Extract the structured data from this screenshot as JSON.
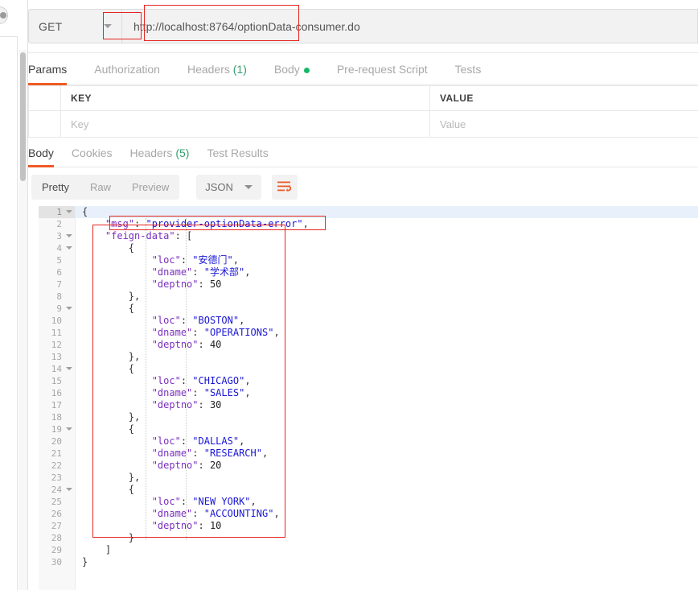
{
  "request": {
    "method": "GET",
    "method_icon": "chevron-down-icon",
    "url": "http://localhost:8764/optionData-consumer.do",
    "tabs": [
      {
        "label": "Params",
        "active": true,
        "suffix": ""
      },
      {
        "label": "Authorization",
        "active": false,
        "suffix": ""
      },
      {
        "label": "Headers",
        "active": false,
        "suffix": "(1)"
      },
      {
        "label": "Body",
        "active": false,
        "suffix": "",
        "dot": true
      },
      {
        "label": "Pre-request Script",
        "active": false,
        "suffix": ""
      },
      {
        "label": "Tests",
        "active": false,
        "suffix": ""
      }
    ]
  },
  "params_table": {
    "headers": [
      "",
      "KEY",
      "VALUE"
    ],
    "rows": [
      {
        "check": "",
        "key_placeholder": "Key",
        "value_placeholder": "Value"
      }
    ]
  },
  "response": {
    "tabs": [
      {
        "label": "Body",
        "active": true,
        "suffix": ""
      },
      {
        "label": "Cookies",
        "active": false,
        "suffix": ""
      },
      {
        "label": "Headers",
        "active": false,
        "suffix": "(5)"
      },
      {
        "label": "Test Results",
        "active": false,
        "suffix": ""
      }
    ],
    "view_modes": [
      {
        "label": "Pretty",
        "active": true
      },
      {
        "label": "Raw",
        "active": false
      },
      {
        "label": "Preview",
        "active": false
      }
    ],
    "format": "JSON",
    "format_icon": "chevron-down-icon",
    "wrap_icon": "wrap-lines-icon"
  },
  "body_json": {
    "msg": "provider-optionData-error",
    "feign-data": [
      {
        "loc": "安德门",
        "dname": "学术部",
        "deptno": 50
      },
      {
        "loc": "BOSTON",
        "dname": "OPERATIONS",
        "deptno": 40
      },
      {
        "loc": "CHICAGO",
        "dname": "SALES",
        "deptno": 30
      },
      {
        "loc": "DALLAS",
        "dname": "RESEARCH",
        "deptno": 20
      },
      {
        "loc": "NEW YORK",
        "dname": "ACCOUNTING",
        "deptno": 10
      }
    ]
  },
  "code_lines": [
    {
      "no": "1",
      "fold": true,
      "current": true,
      "tokens": [
        {
          "t": "{",
          "c": "p"
        }
      ]
    },
    {
      "no": "2",
      "fold": false,
      "current": false,
      "tokens": [
        {
          "t": "    ",
          "c": "p"
        },
        {
          "t": "\"msg\"",
          "c": "k"
        },
        {
          "t": ": ",
          "c": "p"
        },
        {
          "t": "\"provider-optionData-error\"",
          "c": "s"
        },
        {
          "t": ",",
          "c": "p"
        }
      ]
    },
    {
      "no": "3",
      "fold": true,
      "current": false,
      "tokens": [
        {
          "t": "    ",
          "c": "p"
        },
        {
          "t": "\"feign-data\"",
          "c": "k"
        },
        {
          "t": ": [",
          "c": "p"
        }
      ]
    },
    {
      "no": "4",
      "fold": true,
      "current": false,
      "tokens": [
        {
          "t": "        {",
          "c": "p"
        }
      ]
    },
    {
      "no": "5",
      "fold": false,
      "current": false,
      "tokens": [
        {
          "t": "            ",
          "c": "p"
        },
        {
          "t": "\"loc\"",
          "c": "k"
        },
        {
          "t": ": ",
          "c": "p"
        },
        {
          "t": "\"安德门\"",
          "c": "s"
        },
        {
          "t": ",",
          "c": "p"
        }
      ]
    },
    {
      "no": "6",
      "fold": false,
      "current": false,
      "tokens": [
        {
          "t": "            ",
          "c": "p"
        },
        {
          "t": "\"dname\"",
          "c": "k"
        },
        {
          "t": ": ",
          "c": "p"
        },
        {
          "t": "\"学术部\"",
          "c": "s"
        },
        {
          "t": ",",
          "c": "p"
        }
      ]
    },
    {
      "no": "7",
      "fold": false,
      "current": false,
      "tokens": [
        {
          "t": "            ",
          "c": "p"
        },
        {
          "t": "\"deptno\"",
          "c": "k"
        },
        {
          "t": ": ",
          "c": "p"
        },
        {
          "t": "50",
          "c": "n"
        }
      ]
    },
    {
      "no": "8",
      "fold": false,
      "current": false,
      "tokens": [
        {
          "t": "        },",
          "c": "p"
        }
      ]
    },
    {
      "no": "9",
      "fold": true,
      "current": false,
      "tokens": [
        {
          "t": "        {",
          "c": "p"
        }
      ]
    },
    {
      "no": "10",
      "fold": false,
      "current": false,
      "tokens": [
        {
          "t": "            ",
          "c": "p"
        },
        {
          "t": "\"loc\"",
          "c": "k"
        },
        {
          "t": ": ",
          "c": "p"
        },
        {
          "t": "\"BOSTON\"",
          "c": "s"
        },
        {
          "t": ",",
          "c": "p"
        }
      ]
    },
    {
      "no": "11",
      "fold": false,
      "current": false,
      "tokens": [
        {
          "t": "            ",
          "c": "p"
        },
        {
          "t": "\"dname\"",
          "c": "k"
        },
        {
          "t": ": ",
          "c": "p"
        },
        {
          "t": "\"OPERATIONS\"",
          "c": "s"
        },
        {
          "t": ",",
          "c": "p"
        }
      ]
    },
    {
      "no": "12",
      "fold": false,
      "current": false,
      "tokens": [
        {
          "t": "            ",
          "c": "p"
        },
        {
          "t": "\"deptno\"",
          "c": "k"
        },
        {
          "t": ": ",
          "c": "p"
        },
        {
          "t": "40",
          "c": "n"
        }
      ]
    },
    {
      "no": "13",
      "fold": false,
      "current": false,
      "tokens": [
        {
          "t": "        },",
          "c": "p"
        }
      ]
    },
    {
      "no": "14",
      "fold": true,
      "current": false,
      "tokens": [
        {
          "t": "        {",
          "c": "p"
        }
      ]
    },
    {
      "no": "15",
      "fold": false,
      "current": false,
      "tokens": [
        {
          "t": "            ",
          "c": "p"
        },
        {
          "t": "\"loc\"",
          "c": "k"
        },
        {
          "t": ": ",
          "c": "p"
        },
        {
          "t": "\"CHICAGO\"",
          "c": "s"
        },
        {
          "t": ",",
          "c": "p"
        }
      ]
    },
    {
      "no": "16",
      "fold": false,
      "current": false,
      "tokens": [
        {
          "t": "            ",
          "c": "p"
        },
        {
          "t": "\"dname\"",
          "c": "k"
        },
        {
          "t": ": ",
          "c": "p"
        },
        {
          "t": "\"SALES\"",
          "c": "s"
        },
        {
          "t": ",",
          "c": "p"
        }
      ]
    },
    {
      "no": "17",
      "fold": false,
      "current": false,
      "tokens": [
        {
          "t": "            ",
          "c": "p"
        },
        {
          "t": "\"deptno\"",
          "c": "k"
        },
        {
          "t": ": ",
          "c": "p"
        },
        {
          "t": "30",
          "c": "n"
        }
      ]
    },
    {
      "no": "18",
      "fold": false,
      "current": false,
      "tokens": [
        {
          "t": "        },",
          "c": "p"
        }
      ]
    },
    {
      "no": "19",
      "fold": true,
      "current": false,
      "tokens": [
        {
          "t": "        {",
          "c": "p"
        }
      ]
    },
    {
      "no": "20",
      "fold": false,
      "current": false,
      "tokens": [
        {
          "t": "            ",
          "c": "p"
        },
        {
          "t": "\"loc\"",
          "c": "k"
        },
        {
          "t": ": ",
          "c": "p"
        },
        {
          "t": "\"DALLAS\"",
          "c": "s"
        },
        {
          "t": ",",
          "c": "p"
        }
      ]
    },
    {
      "no": "21",
      "fold": false,
      "current": false,
      "tokens": [
        {
          "t": "            ",
          "c": "p"
        },
        {
          "t": "\"dname\"",
          "c": "k"
        },
        {
          "t": ": ",
          "c": "p"
        },
        {
          "t": "\"RESEARCH\"",
          "c": "s"
        },
        {
          "t": ",",
          "c": "p"
        }
      ]
    },
    {
      "no": "22",
      "fold": false,
      "current": false,
      "tokens": [
        {
          "t": "            ",
          "c": "p"
        },
        {
          "t": "\"deptno\"",
          "c": "k"
        },
        {
          "t": ": ",
          "c": "p"
        },
        {
          "t": "20",
          "c": "n"
        }
      ]
    },
    {
      "no": "23",
      "fold": false,
      "current": false,
      "tokens": [
        {
          "t": "        },",
          "c": "p"
        }
      ]
    },
    {
      "no": "24",
      "fold": true,
      "current": false,
      "tokens": [
        {
          "t": "        {",
          "c": "p"
        }
      ]
    },
    {
      "no": "25",
      "fold": false,
      "current": false,
      "tokens": [
        {
          "t": "            ",
          "c": "p"
        },
        {
          "t": "\"loc\"",
          "c": "k"
        },
        {
          "t": ": ",
          "c": "p"
        },
        {
          "t": "\"NEW YORK\"",
          "c": "s"
        },
        {
          "t": ",",
          "c": "p"
        }
      ]
    },
    {
      "no": "26",
      "fold": false,
      "current": false,
      "tokens": [
        {
          "t": "            ",
          "c": "p"
        },
        {
          "t": "\"dname\"",
          "c": "k"
        },
        {
          "t": ": ",
          "c": "p"
        },
        {
          "t": "\"ACCOUNTING\"",
          "c": "s"
        },
        {
          "t": ",",
          "c": "p"
        }
      ]
    },
    {
      "no": "27",
      "fold": false,
      "current": false,
      "tokens": [
        {
          "t": "            ",
          "c": "p"
        },
        {
          "t": "\"deptno\"",
          "c": "k"
        },
        {
          "t": ": ",
          "c": "p"
        },
        {
          "t": "10",
          "c": "n"
        }
      ]
    },
    {
      "no": "28",
      "fold": false,
      "current": false,
      "tokens": [
        {
          "t": "        }",
          "c": "p"
        }
      ]
    },
    {
      "no": "29",
      "fold": false,
      "current": false,
      "tokens": [
        {
          "t": "    ]",
          "c": "p"
        }
      ]
    },
    {
      "no": "30",
      "fold": false,
      "current": false,
      "tokens": [
        {
          "t": "}",
          "c": "p"
        }
      ]
    }
  ],
  "annotations": {
    "color": "#e52521",
    "boxes": [
      "url-port-highlight",
      "url-path-highlight",
      "msg-line-highlight",
      "feign-data-block-highlight"
    ]
  }
}
